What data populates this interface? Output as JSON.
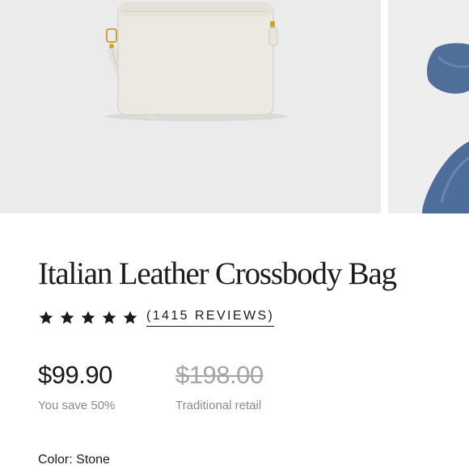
{
  "product": {
    "title": "Italian Leather Crossbody Bag",
    "rating": {
      "stars": 5,
      "open_paren": "(",
      "reviews_count": "1415",
      "reviews_word": "REVIEWS",
      "close_paren": ")"
    },
    "price": "$99.90",
    "savings": "You save 50%",
    "original_price": "$198.00",
    "original_label": "Traditional retail",
    "color_label": "Color:",
    "color_value": "Stone"
  },
  "gallery": {
    "images": [
      {
        "subject": "stone-crossbody-bag"
      },
      {
        "subject": "denim-model-partial"
      }
    ]
  },
  "colors": {
    "text": "#1a1a1a",
    "muted": "#8a8a8a",
    "strike": "#a5a5a5",
    "image_bg": "#ebebeb",
    "bag": "#ece9e2",
    "denim": "#4e6f99"
  }
}
